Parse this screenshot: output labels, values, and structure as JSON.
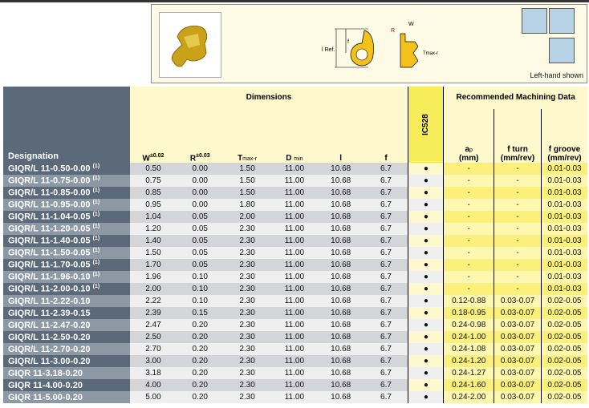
{
  "figure": {
    "note": "Left-hand shown",
    "labels": {
      "l_ref": "l Ref.",
      "f": "f",
      "w": "W",
      "r": "R",
      "tmax": "Tmax-r"
    }
  },
  "header": {
    "dimensions": "Dimensions",
    "recommended": "Recommended  Machining Data",
    "designation": "Designation",
    "w": "W",
    "w_tol": "±0.02",
    "r": "R",
    "r_tol": "±0.03",
    "t": "T",
    "t_sub": "max-r",
    "d": "D",
    "d_sub": "min",
    "l": "l",
    "f": "f",
    "grade": "IC528",
    "ap": "a",
    "ap_sub": "p",
    "ap_unit": "(mm)",
    "fturn": "f turn",
    "fturn_unit": "(mm/rev)",
    "fgroove": "f groove",
    "fgroove_unit": "(mm/rev)"
  },
  "rows": [
    {
      "des": "GIQR/L 11-0.50-0.00",
      "note": "(1)",
      "w": "0.50",
      "r": "0.00",
      "t": "1.50",
      "d": "11.00",
      "l": "10.68",
      "f": "6.7",
      "ic": "●",
      "ap": "-",
      "ft": "-",
      "fg": "0.01-0.03"
    },
    {
      "des": "GIQR/L 11-0.75-0.00",
      "note": "(1)",
      "w": "0.75",
      "r": "0.00",
      "t": "1.50",
      "d": "11.00",
      "l": "10.68",
      "f": "6.7",
      "ic": "●",
      "ap": "-",
      "ft": "-",
      "fg": "0.01-0.03"
    },
    {
      "des": "GIQR/L 11-0.85-0.00",
      "note": "(1)",
      "w": "0.85",
      "r": "0.00",
      "t": "1.50",
      "d": "11.00",
      "l": "10.68",
      "f": "6.7",
      "ic": "●",
      "ap": "-",
      "ft": "-",
      "fg": "0.01-0.03"
    },
    {
      "des": "GIQR/L 11-0.95-0.00",
      "note": "(1)",
      "w": "0.95",
      "r": "0.00",
      "t": "1.80",
      "d": "11.00",
      "l": "10.68",
      "f": "6.7",
      "ic": "●",
      "ap": "-",
      "ft": "-",
      "fg": "0.01-0.03"
    },
    {
      "des": "GIQR/L 11-1.04-0.05",
      "note": "(1)",
      "w": "1.04",
      "r": "0.05",
      "t": "2.00",
      "d": "11.00",
      "l": "10.68",
      "f": "6.7",
      "ic": "●",
      "ap": "-",
      "ft": "-",
      "fg": "0.01-0.03"
    },
    {
      "des": "GIQR/L 11-1.20-0.05",
      "note": "(1)",
      "w": "1.20",
      "r": "0.05",
      "t": "2.30",
      "d": "11.00",
      "l": "10.68",
      "f": "6.7",
      "ic": "●",
      "ap": "-",
      "ft": "-",
      "fg": "0.01-0.03"
    },
    {
      "des": "GIQR/L 11-1.40-0.05",
      "note": "(1)",
      "w": "1.40",
      "r": "0.05",
      "t": "2.30",
      "d": "11.00",
      "l": "10.68",
      "f": "6.7",
      "ic": "●",
      "ap": "-",
      "ft": "-",
      "fg": "0.01-0.03"
    },
    {
      "des": "GIQR/L 11-1.50-0.05",
      "note": "(1)",
      "w": "1.50",
      "r": "0.05",
      "t": "2.30",
      "d": "11.00",
      "l": "10.68",
      "f": "6.7",
      "ic": "●",
      "ap": "-",
      "ft": "-",
      "fg": "0.01-0.03"
    },
    {
      "des": "GIQR/L 11-1.70-0.05",
      "note": "(1)",
      "w": "1.70",
      "r": "0.05",
      "t": "2.30",
      "d": "11.00",
      "l": "10.68",
      "f": "6.7",
      "ic": "●",
      "ap": "-",
      "ft": "-",
      "fg": "0.01-0.03"
    },
    {
      "des": "GIQR/L 11-1.96-0.10",
      "note": "(1)",
      "w": "1.96",
      "r": "0.10",
      "t": "2.30",
      "d": "11.00",
      "l": "10.68",
      "f": "6.7",
      "ic": "●",
      "ap": "-",
      "ft": "-",
      "fg": "0.01-0.03"
    },
    {
      "des": "GIQR/L 11-2.00-0.10",
      "note": "(1)",
      "w": "2.00",
      "r": "0.10",
      "t": "2.30",
      "d": "11.00",
      "l": "10.68",
      "f": "6.7",
      "ic": "●",
      "ap": "-",
      "ft": "-",
      "fg": "0.01-0.03"
    },
    {
      "des": "GIQR/L 11-2.22-0.10",
      "note": "",
      "w": "2.22",
      "r": "0.10",
      "t": "2.30",
      "d": "11.00",
      "l": "10.68",
      "f": "6.7",
      "ic": "●",
      "ap": "0.12-0.88",
      "ft": "0.03-0.07",
      "fg": "0.02-0.05"
    },
    {
      "des": "GIQR/L 11-2.39-0.15",
      "note": "",
      "w": "2.39",
      "r": "0.15",
      "t": "2.30",
      "d": "11.00",
      "l": "10.68",
      "f": "6.7",
      "ic": "●",
      "ap": "0.18-0.95",
      "ft": "0.03-0.07",
      "fg": "0.02-0.05"
    },
    {
      "des": "GIQR/L 11-2.47-0.20",
      "note": "",
      "w": "2.47",
      "r": "0.20",
      "t": "2.30",
      "d": "11.00",
      "l": "10.68",
      "f": "6.7",
      "ic": "●",
      "ap": "0.24-0.98",
      "ft": "0.03-0.07",
      "fg": "0.02-0.05"
    },
    {
      "des": "GIQR/L 11-2.50-0.20",
      "note": "",
      "w": "2.50",
      "r": "0.20",
      "t": "2.30",
      "d": "11.00",
      "l": "10.68",
      "f": "6.7",
      "ic": "●",
      "ap": "0.24-1.00",
      "ft": "0.03-0.07",
      "fg": "0.02-0.05"
    },
    {
      "des": "GIQR/L 11-2.70-0.20",
      "note": "",
      "w": "2.70",
      "r": "0.20",
      "t": "2.30",
      "d": "11.00",
      "l": "10.68",
      "f": "6.7",
      "ic": "●",
      "ap": "0.24-1.08",
      "ft": "0.03-0.07",
      "fg": "0.02-0.05"
    },
    {
      "des": "GIQR/L 11-3.00-0.20",
      "note": "",
      "w": "3.00",
      "r": "0.20",
      "t": "2.30",
      "d": "11.00",
      "l": "10.68",
      "f": "6.7",
      "ic": "●",
      "ap": "0.24-1.20",
      "ft": "0.03-0.07",
      "fg": "0.02-0.05"
    },
    {
      "des": "GIQR 11-3.18-0.20",
      "note": "",
      "w": "3.18",
      "r": "0.20",
      "t": "2.30",
      "d": "11.00",
      "l": "10.68",
      "f": "6.7",
      "ic": "●",
      "ap": "0.24-1.27",
      "ft": "0.03-0.07",
      "fg": "0.02-0.05"
    },
    {
      "des": "GIQR 11-4.00-0.20",
      "note": "",
      "w": "4.00",
      "r": "0.20",
      "t": "2.30",
      "d": "11.00",
      "l": "10.68",
      "f": "6.7",
      "ic": "●",
      "ap": "0.24-1.60",
      "ft": "0.03-0.07",
      "fg": "0.02-0.05"
    },
    {
      "des": "GIQR 11-5.00-0.20",
      "note": "",
      "w": "5.00",
      "r": "0.20",
      "t": "2.30",
      "d": "11.00",
      "l": "10.68",
      "f": "6.7",
      "ic": "●",
      "ap": "0.24-2.00",
      "ft": "0.03-0.07",
      "fg": "0.02-0.05"
    }
  ]
}
